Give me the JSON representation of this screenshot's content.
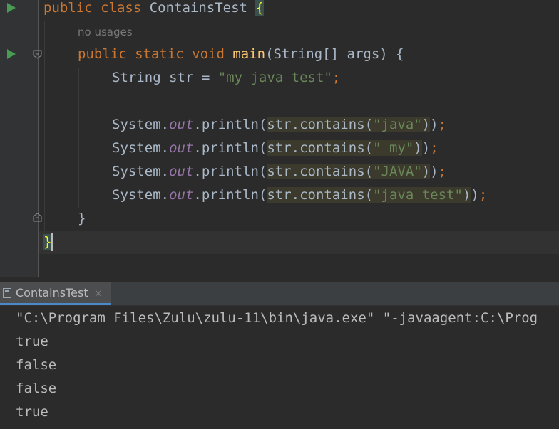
{
  "editor": {
    "hint_no_usages": "no usages",
    "lines": {
      "class_kw": "public class ",
      "class_name": "ContainsTest ",
      "class_open": "{",
      "method_kw": "public static void ",
      "method_name": "main",
      "method_params": "(String[] args) {",
      "decl_type": "String str = ",
      "decl_value": "\"my java test\"",
      "decl_end": ";",
      "close_method": "}",
      "close_class": "}"
    },
    "prints": [
      {
        "prefix": "System.",
        "field": "out",
        "call": ".println(",
        "target": "str.contains(",
        "arg": "\"java\"",
        "close": ")",
        "end_paren": ")",
        "semi": ";"
      },
      {
        "prefix": "System.",
        "field": "out",
        "call": ".println(",
        "target": "str.contains(",
        "arg": "\" my\"",
        "close": ")",
        "end_paren": ")",
        "semi": ";"
      },
      {
        "prefix": "System.",
        "field": "out",
        "call": ".println(",
        "target": "str.contains(",
        "arg": "\"JAVA\"",
        "close": ")",
        "end_paren": ")",
        "semi": ";"
      },
      {
        "prefix": "System.",
        "field": "out",
        "call": ".println(",
        "target": "str.contains(",
        "arg": "\"java test\"",
        "close": ")",
        "end_paren": ")",
        "semi": ";"
      }
    ]
  },
  "run_panel": {
    "tab_label": "ContainsTest",
    "tab_close": "×",
    "output": [
      "\"C:\\Program Files\\Zulu\\zulu-11\\bin\\java.exe\" \"-javaagent:C:\\Prog",
      "true",
      "false",
      "false",
      "true"
    ]
  },
  "colors": {
    "keyword": "#cc7832",
    "string": "#6a8759",
    "field": "#9876aa",
    "method": "#ffc66d",
    "text": "#a9b7c6",
    "run_icon": "#499c54"
  },
  "icons": [
    "run-icon",
    "fold-icon",
    "console-tab-icon",
    "close-icon"
  ]
}
